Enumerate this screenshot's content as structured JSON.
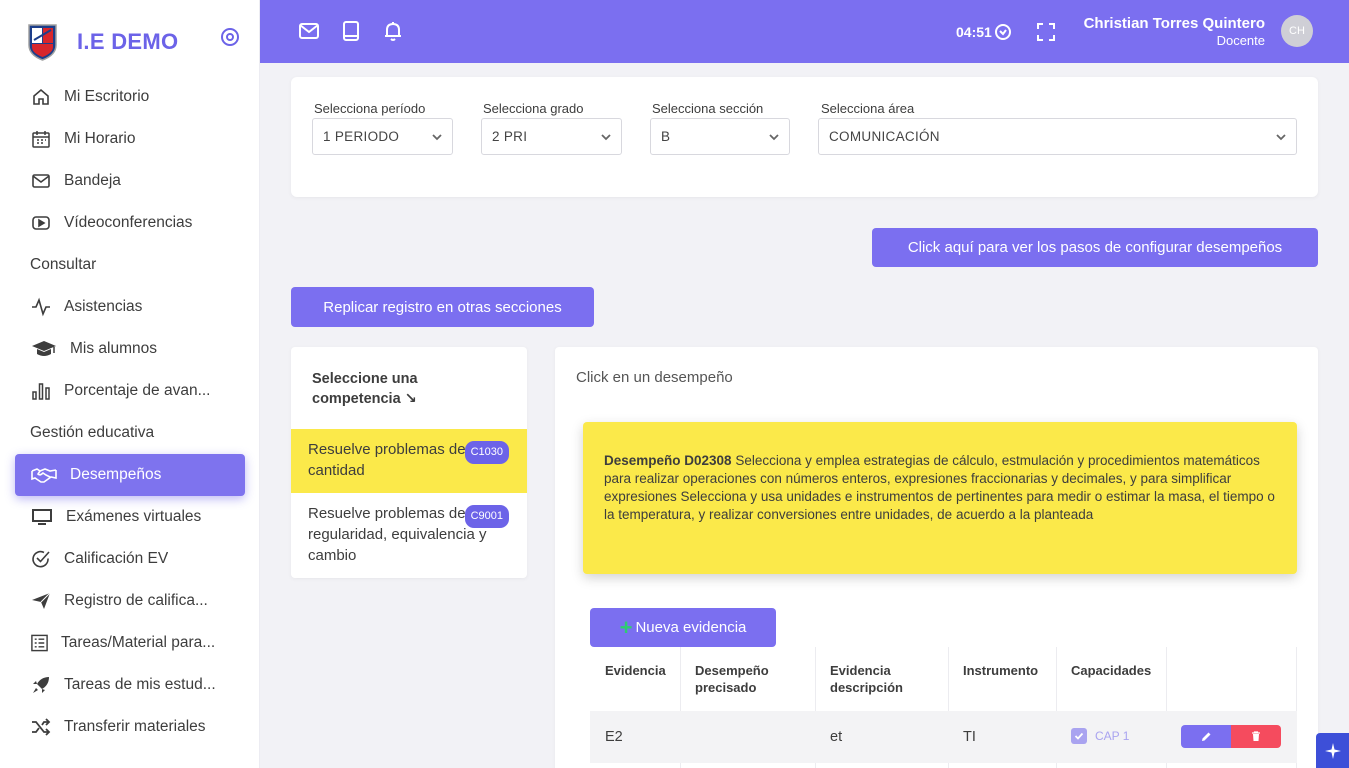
{
  "brand": {
    "name": "I.E DEMO",
    "logo_icon": "school-crest-icon"
  },
  "sidebar": {
    "items": [
      {
        "label": "Mi Escritorio",
        "icon": "home-icon"
      },
      {
        "label": "Mi Horario",
        "icon": "calendar-icon"
      },
      {
        "label": "Bandeja",
        "icon": "mail-icon"
      },
      {
        "label": "Vídeoconferencias",
        "icon": "video-icon"
      }
    ],
    "section_consultar": "Consultar",
    "items_consultar": [
      {
        "label": "Asistencias",
        "icon": "activity-icon"
      },
      {
        "label": "Mis alumnos",
        "icon": "graduation-cap-icon"
      },
      {
        "label": "Porcentaje de avan...",
        "icon": "bar-chart-icon"
      }
    ],
    "section_gestion": "Gestión educativa",
    "items_gestion": [
      {
        "label": "Desempeños",
        "icon": "handshake-icon"
      },
      {
        "label": "Exámenes virtuales",
        "icon": "monitor-icon"
      },
      {
        "label": "Calificación EV",
        "icon": "check-circle-icon"
      },
      {
        "label": "Registro de califica...",
        "icon": "send-icon"
      },
      {
        "label": "Tareas/Material para...",
        "icon": "list-icon"
      },
      {
        "label": "Tareas de mis estud...",
        "icon": "rocket-icon"
      },
      {
        "label": "Transferir materiales",
        "icon": "shuffle-icon"
      }
    ]
  },
  "header": {
    "clock": "04:51",
    "user_name": "Christian Torres Quintero",
    "user_role": "Docente",
    "avatar_initials": "CH"
  },
  "filters": {
    "periodo": {
      "label": "Selecciona período",
      "value": "1 PERIODO"
    },
    "grado": {
      "label": "Selecciona grado",
      "value": "2 PRI"
    },
    "seccion": {
      "label": "Selecciona sección",
      "value": "B"
    },
    "area": {
      "label": "Selecciona área",
      "value": "COMUNICACIÓN"
    }
  },
  "buttons": {
    "pasos": "Click aquí para ver los pasos de configurar desempeños",
    "replicar": "Replicar registro en otras secciones",
    "nueva_evidencia": "Nueva evidencia"
  },
  "competencias": {
    "title": "Seleccione una competencia ↘",
    "items": [
      {
        "label": "Resuelve problemas de cantidad",
        "code": "C1030"
      },
      {
        "label": "Resuelve problemas de regularidad, equivalencia y cambio",
        "code": "C9001"
      }
    ]
  },
  "desempeno": {
    "hint": "Click en un desempeño",
    "title": "Desempeño D02308",
    "text": "Selecciona y emplea estrategias de cálculo, estmulación y procedimientos matemáticos para realizar operaciones con números enteros, expresiones fraccionarias y decimales, y para simplificar expresiones Selecciona y usa unidades e instrumentos de pertinentes para medir o estimar la masa, el tiempo o la temperatura, y realizar conversiones entre unidades, de acuerdo a la planteada"
  },
  "table": {
    "headers": [
      "Evidencia",
      "Desempeño precisado",
      "Evidencia descripción",
      "Instrumento",
      "Capacidades"
    ],
    "rows": [
      {
        "evidencia": "E2",
        "precisado": "",
        "descripcion": "et",
        "instrumento": "TI",
        "capacidad": "CAP 1"
      }
    ]
  },
  "colors": {
    "accent": "#7b6ff0",
    "highlight": "#fbe94a",
    "danger": "#f54b5e"
  }
}
